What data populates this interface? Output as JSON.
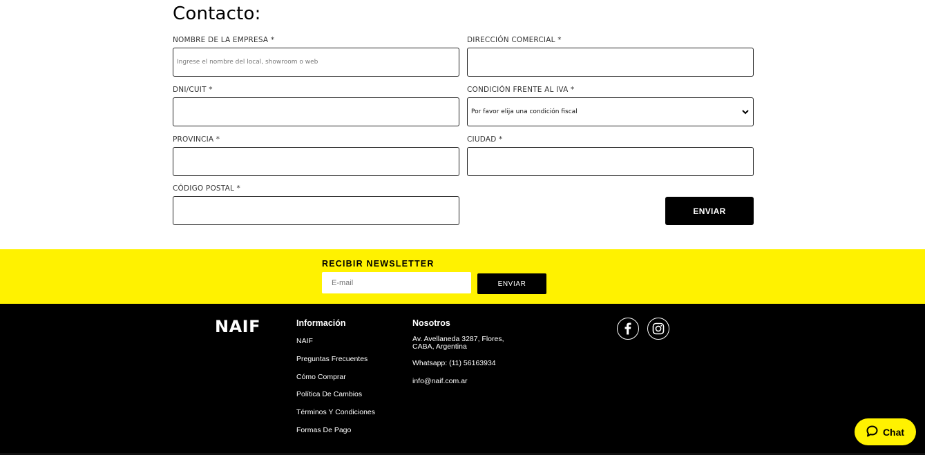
{
  "form": {
    "title": "Contacto:",
    "fields": {
      "empresa": {
        "label": "NOMBRE DE LA EMPRESA *",
        "placeholder": "Ingrese el nombre del local, showroom o web",
        "value": ""
      },
      "direccion": {
        "label": "DIRECCIÓN COMERCIAL *",
        "value": ""
      },
      "dni": {
        "label": "DNI/CUIT *",
        "value": ""
      },
      "iva": {
        "label": "CONDICIÓN FRENTE AL IVA *",
        "selected": "Por favor elija una condición fiscal"
      },
      "provincia": {
        "label": "PROVINCIA *",
        "value": ""
      },
      "ciudad": {
        "label": "CIUDAD *",
        "value": ""
      },
      "postal": {
        "label": "CÓDIGO POSTAL *",
        "value": ""
      }
    },
    "submit_label": "ENVIAR"
  },
  "newsletter": {
    "title": "RECIBIR NEWSLETTER",
    "email_placeholder": "E-mail",
    "button_label": "ENVIAR",
    "background_color": "#fff200"
  },
  "footer": {
    "logo": "NAIF",
    "info": {
      "title": "Información",
      "links": [
        "NAIF",
        "Preguntas Frecuentes",
        "Cómo Comprar",
        "Política De Cambios",
        "Términos Y Condiciones",
        "Formas De Pago"
      ]
    },
    "nosotros": {
      "title": "Nosotros",
      "address_line1": "Av. Avellaneda 3287, Flores,",
      "address_line2": "CABA, Argentina",
      "whatsapp": "Whatsapp: (11) 56163934",
      "email": "info@naif.com.ar"
    },
    "social": [
      "facebook-icon",
      "instagram-icon"
    ]
  },
  "chat": {
    "label": "Chat",
    "icon": "chat-bubble-icon"
  }
}
